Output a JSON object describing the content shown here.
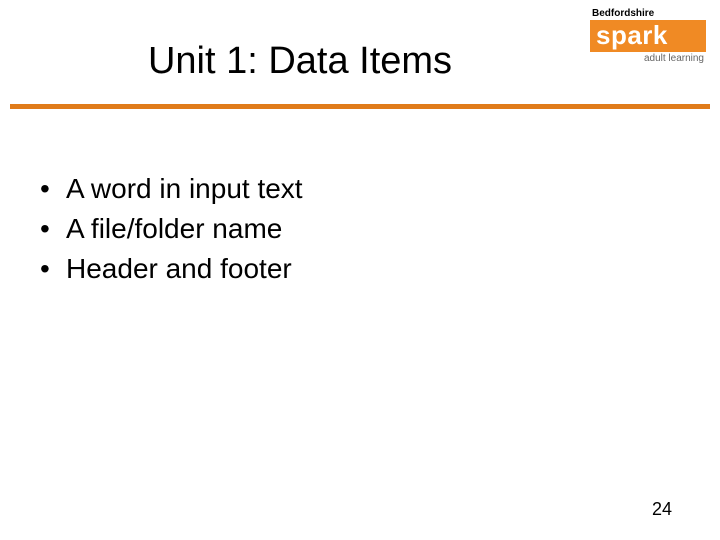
{
  "logo": {
    "top": "Bedfordshire",
    "brand": "spark",
    "bottom": "adult learning"
  },
  "title": "Unit 1: Data Items",
  "bullets": [
    "A word in input text",
    "A file/folder name",
    "Header and footer"
  ],
  "page_number": "24",
  "colors": {
    "accent": "#e07b1a"
  }
}
